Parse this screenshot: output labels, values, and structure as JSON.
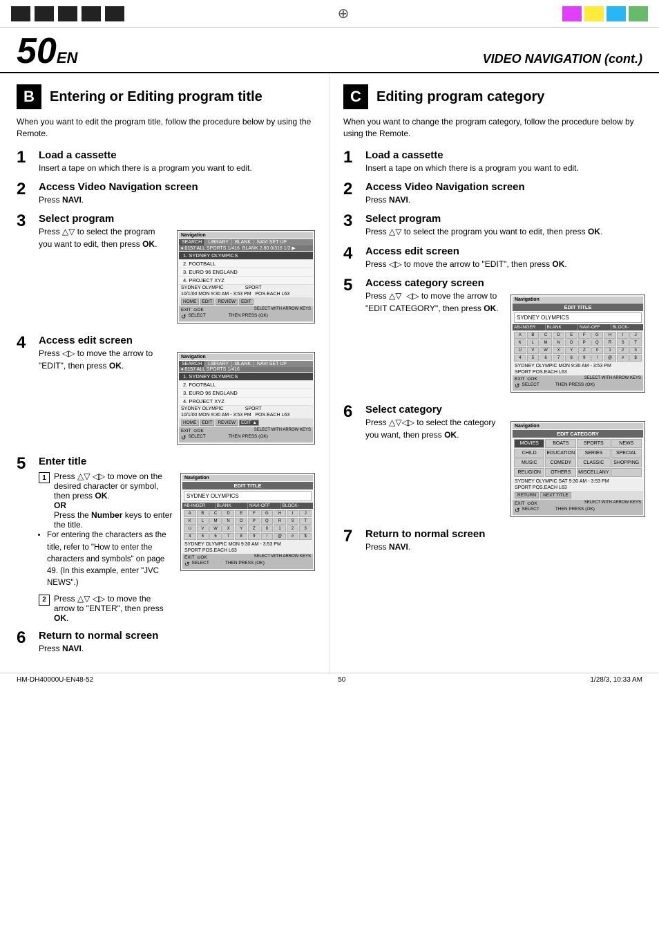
{
  "topBar": {
    "blackSquares": [
      "sq1",
      "sq2",
      "sq3",
      "sq4",
      "sq5"
    ],
    "centerSymbol": "⊕",
    "colorSquares": [
      {
        "color": "#e040fb"
      },
      {
        "color": "#ffeb3b"
      },
      {
        "color": "#29b6f6"
      },
      {
        "color": "#66bb6a"
      }
    ]
  },
  "pageHeader": {
    "pageNum": "50",
    "suffix": "EN",
    "title": "VIDEO NAVIGATION (cont.)"
  },
  "sectionB": {
    "letter": "B",
    "title": "Entering or Editing program title",
    "intro": "When you want to edit the program title, follow the procedure below by using the Remote.",
    "steps": [
      {
        "num": "1",
        "heading": "Load a cassette",
        "body": "Insert a tape on which there is a program you want to edit."
      },
      {
        "num": "2",
        "heading": "Access Video Navigation screen",
        "body": "Press NAVI."
      },
      {
        "num": "3",
        "heading": "Select program",
        "body": "Press △▽ to select the program you want to edit, then press OK."
      },
      {
        "num": "4",
        "heading": "Access edit screen",
        "body": "Press ◁▷ to move the arrow to \"EDIT\", then press OK."
      },
      {
        "num": "5",
        "heading": "Enter title",
        "subSteps": [
          {
            "num": "1",
            "text": "Press △▽ ◁▷ to move on the desired character or symbol, then press OK.",
            "bold": "OR"
          },
          {
            "num": "2",
            "text": "Press △▽ ◁▷ to move the arrow to \"ENTER\", then press OK."
          }
        ],
        "numberKeysText": "Press the Number keys to enter the title.",
        "bullets": [
          "For entering the characters as the title, refer to \"How to enter the characters and symbols\" on page 49. (In this example, enter \"JVC NEWS\".)"
        ]
      },
      {
        "num": "6",
        "heading": "Return to normal screen",
        "body": "Press NAVI."
      }
    ]
  },
  "sectionC": {
    "letter": "C",
    "title": "Editing program category",
    "intro": "When you want to change the program category, follow the procedure below by using the Remote.",
    "steps": [
      {
        "num": "1",
        "heading": "Load a cassette",
        "body": "Insert a tape on which there is a program you want to edit."
      },
      {
        "num": "2",
        "heading": "Access Video Navigation screen",
        "body": "Press NAVI."
      },
      {
        "num": "3",
        "heading": "Select program",
        "body": "Press △▽ to select the program you want to edit, then press OK."
      },
      {
        "num": "4",
        "heading": "Access edit screen",
        "body": "Press ◁▷ to move the arrow to \"EDIT\", then press OK."
      },
      {
        "num": "5",
        "heading": "Access category screen",
        "body": "Press △▽ ◁▷ to move the arrow to \"EDIT CATEGORY\", then press OK."
      },
      {
        "num": "6",
        "heading": "Select category",
        "body": "Press △▽◁▷ to select the category you want, then press OK."
      },
      {
        "num": "7",
        "heading": "Return to normal screen",
        "body": "Press NAVI."
      }
    ]
  },
  "bottomBar": {
    "modelNum": "HM-DH40000U-EN48-52",
    "pageNum": "50",
    "date": "1/28/3, 10:33 AM"
  },
  "screens": {
    "navigation1": {
      "header": "Navigation",
      "tabs": [
        "SEARCH",
        "LIBRARY",
        "BLANK",
        "NAVI SET UP"
      ],
      "titleBar": "♦ 0157 ALL SPORTS 1/416    BLANK 2.80 0/316   1/2 ▶",
      "items": [
        "1. SYDNEY OLYMPICS",
        "2. FOOTBALL",
        "3. EURO 96 ENGLAND",
        "4. PROJECT XYZ"
      ],
      "status": "SYDNEY OLYMPIC                                SPORT",
      "statusRight": "10/1/00 MON  9:30 AM - 3:53 PM      POS.EACH  L63",
      "buttons": [
        "HOME",
        "EDIT",
        "REVIEW",
        "EDIT"
      ],
      "footer": "EXIT    OK    SELECT WITH ARROW KEYS    THEN PRESS (OK)",
      "selectLabel": "SELECT"
    },
    "navigation2": {
      "header": "Navigation",
      "tabs": [
        "SEARCH",
        "LIBRARY",
        "BLANK",
        "NAVI SET UP"
      ],
      "titleBar": "♦ 0157 ALL SPORTS 1/416",
      "items": [
        "1. SYDNEY OLYMPICS",
        "2. FOOTBALL",
        "3. EURO 96 ENGLAND",
        "4. PROJECT XYZ"
      ],
      "status": "SYDNEY OLYMPIC                                SPORT",
      "statusRight": "10/1/00 MON  9:30 AM - 3:53 PM      POS.EACH  L63",
      "buttons": [
        "HOME",
        "EDIT",
        "REVIEW",
        "EDIT ▲"
      ],
      "footer": "EXIT    OK    SELECT WITH ARROW KEYS    THEN PRESS (OK)",
      "selectLabel": "SELECT"
    },
    "editTitle": {
      "header": "Navigation",
      "subHeader": "EDIT TITLE",
      "inputField": "SYDNEY OLYMPICS",
      "gridHeader": [
        "AB-INGER",
        "BLANK",
        "NAVI-OFF",
        "BLOCK-"
      ],
      "keyboard": [
        "A",
        "B",
        "C",
        "D",
        "E",
        "F",
        "G",
        "H",
        "I",
        "J",
        "K",
        "L",
        "M",
        "N",
        "O",
        "P",
        "Q",
        "R",
        "S",
        "T",
        "U",
        "V",
        "W",
        "X",
        "Y",
        "Z",
        "0",
        "1",
        "2",
        "3",
        "4",
        "5",
        "6",
        "7",
        "8",
        "9",
        "!",
        "@",
        "#",
        "$"
      ],
      "status": "SYDNEY OLYMPIC  MON 9:30 AM - 3:53 PM",
      "statusRight": "SPORT  POS.EACH L63",
      "footer": "EXIT    OK    SELECT WITH ARROW KEYS    THEN PRESS (OK)",
      "selectLabel": "SELECT"
    },
    "editCategory": {
      "header": "Navigation",
      "subHeader": "EDIT TITLE",
      "inputField": "SYDNEY OLYMPICS",
      "gridHeader": [
        "AB-INGER",
        "BLANK",
        "NAVI-OFF",
        "BLOCK-"
      ],
      "keyboard": [
        "A",
        "B",
        "C",
        "D",
        "E",
        "F",
        "G",
        "H",
        "I",
        "J",
        "K",
        "L",
        "M",
        "N",
        "O",
        "P",
        "Q",
        "R",
        "S",
        "T",
        "U",
        "V",
        "W",
        "X",
        "Y",
        "Z",
        "0",
        "1",
        "2",
        "3",
        "4",
        "5",
        "6",
        "7",
        "8",
        "9",
        "!",
        "@",
        "#",
        "$"
      ],
      "status": "SYDNEY OLYMPIC  MON 9:30 AM - 3:53 PM",
      "statusRight": "SPORT  POS.EACH L63",
      "footer": "EXIT    OK    SELECT WITH ARROW KEYS    THEN PRESS (OK)",
      "selectLabel": "SELECT"
    },
    "categorySelect": {
      "header": "Navigation",
      "subHeader": "EDIT CATEGORY",
      "categories": [
        [
          "MOVIES",
          "BOATS",
          "SPORTS",
          "NEWS"
        ],
        [
          "CHILD",
          "EDUCATION",
          "SERIES",
          "SPECIAL"
        ],
        [
          "MUSIC",
          "COMEDY",
          "CLASSIC",
          "SHOPPING"
        ],
        [
          "RELIGION",
          "OTHERS",
          "MISCELLANY",
          ""
        ]
      ],
      "status": "SYDNEY OLYMPIC SAT  9:30 AM - 3:53 PM",
      "statusRight": "SPORT  POS.EACH L63",
      "buttons": [
        "RETURN",
        "NEXT TITLE"
      ],
      "footer": "EXIT    OK    SELECT WITH ARROW KEYS    THEN PRESS (OK)",
      "selectLabel": "SELECT"
    }
  }
}
